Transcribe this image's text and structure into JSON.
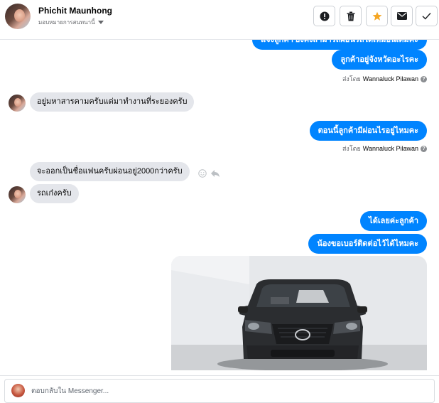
{
  "header": {
    "contact_name": "Phichit Maunhong",
    "assign_label": "มอบหมายการสนทนานี้",
    "toolbar": [
      {
        "name": "spam-alert",
        "icon": "alert-icon",
        "color": "#1c1e21"
      },
      {
        "name": "delete",
        "icon": "trash-icon",
        "color": "#1c1e21"
      },
      {
        "name": "star",
        "icon": "star-icon",
        "color": "#f5a623"
      },
      {
        "name": "mark-unread",
        "icon": "envelope-icon",
        "color": "#1c1e21"
      },
      {
        "name": "mark-done",
        "icon": "check-icon",
        "color": "#1c1e21"
      }
    ]
  },
  "messages": {
    "out_partial": "แจ้งลูกค้า ยังคงสามารถผ่อนรถได้เหมือนเดิมค่ะ",
    "out_province": "ลูกค้าอยู่จังหวัดอะไรคะ",
    "sent_by_label_1": "ส่งโดย",
    "sent_by_name_1": "Wannaluck Pilawan",
    "in_location": "อยู่มหาสารคามครับแต่มาทำงานที่ระยองครับ",
    "out_installment": "ตอนนี้ลูกค้ามีผ่อนไรอยู่ไหมคะ",
    "sent_by_label_2": "ส่งโดย",
    "sent_by_name_2": "Wannaluck Pilawan",
    "in_plan": "จะออกเป็นชื่อแฟนครับผ่อนอยู่2000กว่าครับ",
    "in_car": "รถเก๋งครับ",
    "out_ok": "ได้เลยค่ะลูกค้า",
    "out_phone": "น้องขอเบอร์ติดต่อไว้ได้ไหมคะ"
  },
  "photo": {
    "subject": "black Mazda pickup truck front view"
  },
  "composer": {
    "placeholder": "ตอบกลับใน Messenger..."
  },
  "colors": {
    "accent": "#0084ff",
    "incoming_bubble": "#e4e6eb",
    "star": "#f5a623"
  }
}
